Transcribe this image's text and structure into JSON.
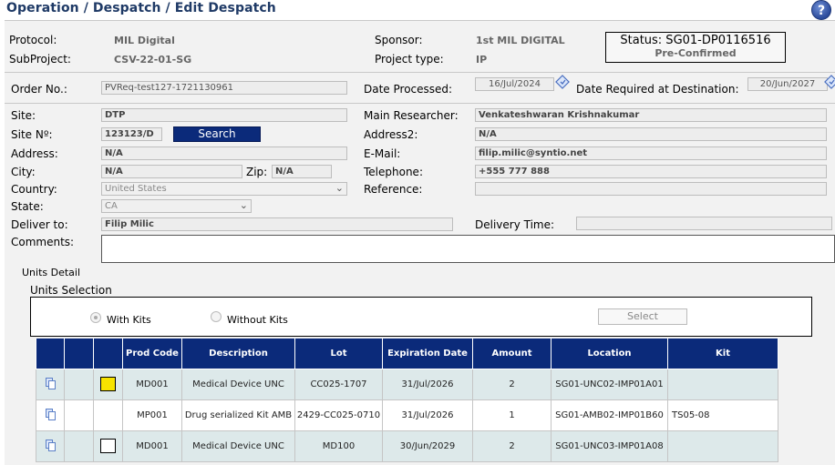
{
  "page": {
    "title": "Operation / Despatch / Edit Despatch",
    "help_icon": "?"
  },
  "header": {
    "protocol_label": "Protocol:",
    "protocol_value": "MIL Digital",
    "subproject_label": "SubProject:",
    "subproject_value": "CSV-22-01-SG",
    "sponsor_label": "Sponsor:",
    "sponsor_value": "1st MIL DIGITAL",
    "project_type_label": "Project type:",
    "project_type_value": "IP",
    "status_text": "Status: SG01-DP0116516",
    "status_sub": "Pre-Confirmed"
  },
  "order": {
    "order_no_label": "Order No.:",
    "order_no_value": "PVReq-test127-1721130961",
    "date_processed_label": "Date Processed:",
    "date_processed_value": "16/Jul/2024",
    "date_required_label": "Date Required at Destination:",
    "date_required_value": "20/Jun/2027"
  },
  "site": {
    "site_label": "Site:",
    "site_value": "DTP",
    "site_no_label": "Site Nº:",
    "site_no_value": "123123/D",
    "search_label": "Search",
    "address_label": "Address:",
    "address_value": "N/A",
    "city_label": "City:",
    "city_value": "N/A",
    "zip_label": "Zip:",
    "zip_value": "N/A",
    "country_label": "Country:",
    "country_value": "United States",
    "state_label": "State:",
    "state_value": "CA",
    "deliver_to_label": "Deliver to:",
    "deliver_to_value": "Filip Milic",
    "comments_label": "Comments:",
    "main_researcher_label": "Main Researcher:",
    "main_researcher_value": "Venkateshwaran Krishnakumar",
    "address2_label": "Address2:",
    "address2_value": "N/A",
    "email_label": "E-Mail:",
    "email_value": "filip.milic@syntio.net",
    "telephone_label": "Telephone:",
    "telephone_value": "+555 777 888",
    "reference_label": "Reference:",
    "reference_value": "",
    "delivery_time_label": "Delivery Time:",
    "delivery_time_value": ""
  },
  "units": {
    "detail_label": "Units Detail",
    "selection_label": "Units Selection",
    "with_kits_label": "With Kits",
    "without_kits_label": "Without Kits",
    "select_button": "Select",
    "columns": [
      "",
      "",
      "",
      "Prod Code",
      "Description",
      "Lot",
      "Expiration Date",
      "Amount",
      "Location",
      "Kit"
    ],
    "rows": [
      {
        "prod_code": "MD001",
        "description": "Medical Device UNC",
        "lot": "CC025-1707",
        "expiration": "31/Jul/2026",
        "amount": "2",
        "location": "SG01-UNC02-IMP01A01",
        "kit": "",
        "checkbox": "yellow"
      },
      {
        "prod_code": "MP001",
        "description": "Drug serialized Kit AMB",
        "lot": "2429-CC025-0710",
        "expiration": "31/Jul/2026",
        "amount": "1",
        "location": "SG01-AMB02-IMP01B60",
        "kit": "TS05-08",
        "checkbox": "none"
      },
      {
        "prod_code": "MD001",
        "description": "Medical Device UNC",
        "lot": "MD100",
        "expiration": "30/Jun/2029",
        "amount": "2",
        "location": "SG01-UNC03-IMP01A08",
        "kit": "",
        "checkbox": "white"
      }
    ]
  },
  "colors": {
    "title": "#1f3a66",
    "header_bg": "#0b2a7a",
    "row_alt": "#dde9ea",
    "checkbox_yellow": "#f7e300"
  }
}
